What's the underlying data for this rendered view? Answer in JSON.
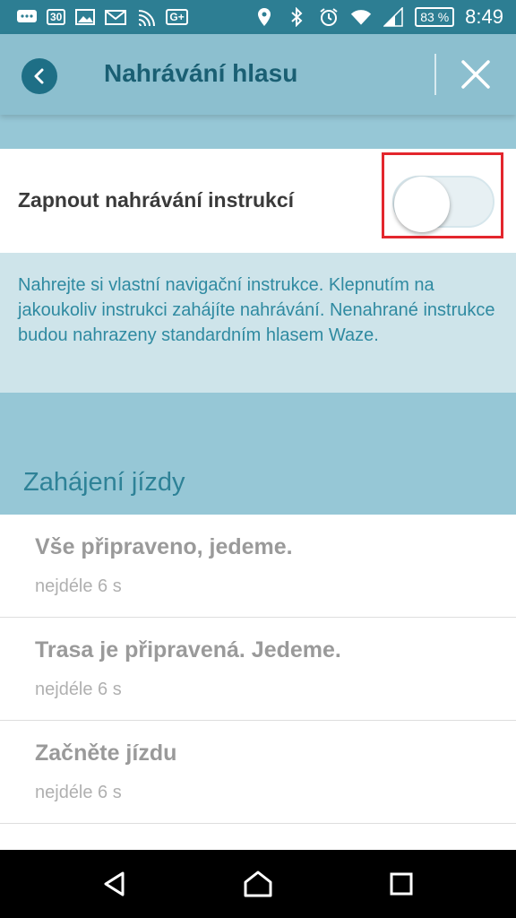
{
  "status_bar": {
    "left_icons": [
      "chat-icon",
      "calendar-icon",
      "image-icon",
      "gmail-icon",
      "cast-icon",
      "google-plus-icon"
    ],
    "calendar_day": "30",
    "battery": "83 %",
    "time": "8:49"
  },
  "header": {
    "title": "Nahrávání hlasu"
  },
  "toggle": {
    "label": "Zapnout nahrávání instrukcí",
    "state": "off"
  },
  "info": {
    "text": "Nahrejte si vlastní navigační instrukce. Klepnutím na jakoukoliv instrukci zahájíte nahrávání. Nenahrané instrukce budou nahrazeny standardním hlasem Waze."
  },
  "section": {
    "title": "Zahájení jízdy"
  },
  "list": {
    "items": [
      {
        "title": "Vše připraveno, jedeme.",
        "subtitle": "nejdéle 6 s"
      },
      {
        "title": "Trasa je připravená. Jedeme.",
        "subtitle": "nejdéle 6 s"
      },
      {
        "title": "Začněte jízdu",
        "subtitle": "nejdéle 6 s"
      }
    ]
  },
  "colors": {
    "status_bar": "#2d7e93",
    "app_bar": "#8cbfcf",
    "accent": "#1e6f86",
    "highlight": "#e3262d"
  }
}
